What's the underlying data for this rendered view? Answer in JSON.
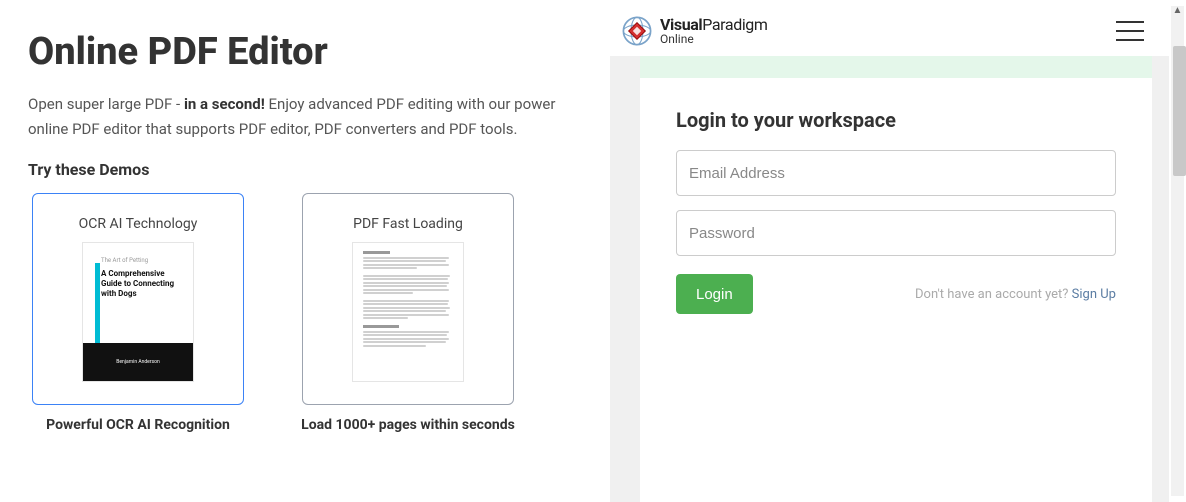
{
  "hero": {
    "title": "Online PDF Editor",
    "subtitle_a": "Open super large PDF - ",
    "subtitle_b": "in a second!",
    "subtitle_c": " Enjoy advanced PDF editing with our power online PDF editor that supports PDF editor, PDF converters and PDF tools.",
    "try_label": "Try these Demos"
  },
  "demos": {
    "ocr": {
      "frame_title": "OCR AI Technology",
      "caption": "Powerful OCR AI Recognition",
      "book_small": "The Art of Petting",
      "book_title": "A Comprehensive Guide to Connecting with Dogs",
      "author": "Benjamin Anderson"
    },
    "fast": {
      "frame_title": "PDF Fast Loading",
      "caption": "Load 1000+ pages within seconds"
    }
  },
  "brand": {
    "line1a": "Visual",
    "line1b": "Paradigm",
    "line2": "Online"
  },
  "login": {
    "title": "Login to your workspace",
    "email_placeholder": "Email Address",
    "password_placeholder": "Password",
    "button": "Login",
    "signup_prompt": "Don't have an account yet? ",
    "signup_link": "Sign Up"
  }
}
